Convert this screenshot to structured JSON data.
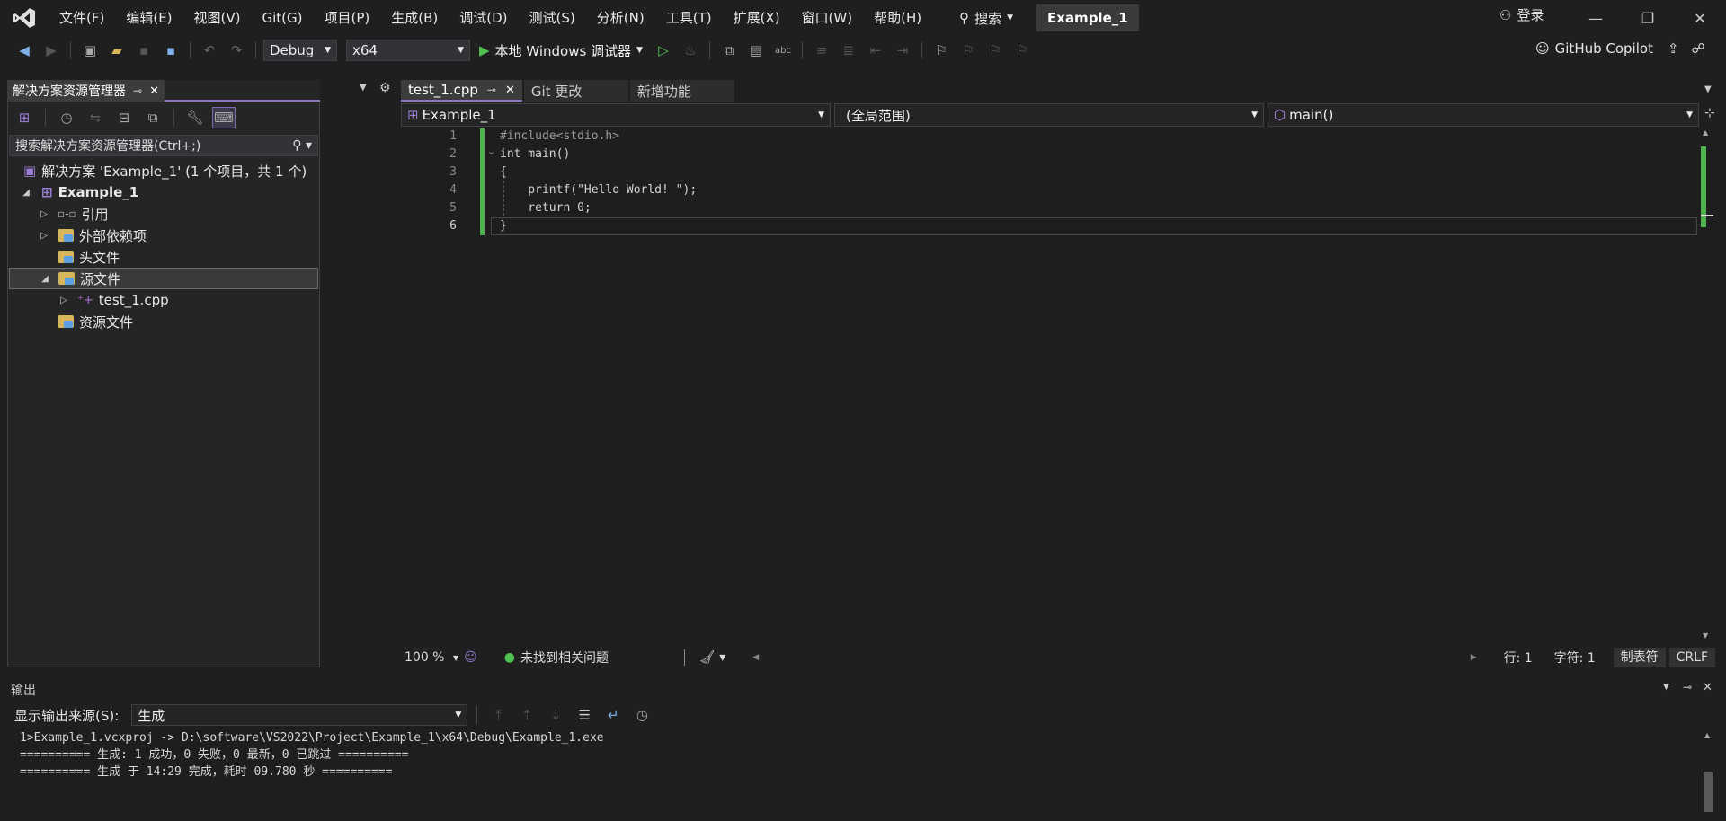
{
  "menu": [
    "文件(F)",
    "编辑(E)",
    "视图(V)",
    "Git(G)",
    "项目(P)",
    "生成(B)",
    "调试(D)",
    "测试(S)",
    "分析(N)",
    "工具(T)",
    "扩展(X)",
    "窗口(W)",
    "帮助(H)"
  ],
  "search_label": "搜索",
  "solution_name": "Example_1",
  "login_label": "登录",
  "toolbar": {
    "config": "Debug",
    "platform": "x64",
    "debugger": "本地 Windows 调试器",
    "copilot": "GitHub Copilot"
  },
  "solution_explorer": {
    "title": "解决方案资源管理器",
    "search_placeholder": "搜索解决方案资源管理器(Ctrl+;)",
    "tree": [
      {
        "label": "解决方案 'Example_1' (1 个项目，共 1 个)"
      },
      {
        "label": "Example_1"
      },
      {
        "label": "引用"
      },
      {
        "label": "外部依赖项"
      },
      {
        "label": "头文件"
      },
      {
        "label": "源文件"
      },
      {
        "label": "test_1.cpp"
      },
      {
        "label": "资源文件"
      }
    ]
  },
  "editor": {
    "tabs": [
      "test_1.cpp",
      "Git 更改",
      "新增功能"
    ],
    "nav": {
      "project": "Example_1",
      "scope": "(全局范围)",
      "member": "main()"
    },
    "lines": [
      {
        "num": "1",
        "text": "#include<stdio.h>"
      },
      {
        "num": "2",
        "text": "int main()"
      },
      {
        "num": "3",
        "text": "{"
      },
      {
        "num": "4",
        "text": "    printf(\"Hello World! \");"
      },
      {
        "num": "5",
        "text": "    return 0;"
      },
      {
        "num": "6",
        "text": "}"
      }
    ],
    "zoom": "100 %",
    "issues": "未找到相关问题",
    "row": "行: 1",
    "col": "字符: 1",
    "indent": "制表符",
    "eol": "CRLF"
  },
  "output": {
    "title": "输出",
    "source_label": "显示输出来源(S):",
    "source_value": "生成",
    "lines": [
      "1>Example_1.vcxproj -> D:\\software\\VS2022\\Project\\Example_1\\x64\\Debug\\Example_1.exe",
      "========== 生成: 1 成功，0 失败，0 最新，0 已跳过 ==========",
      "========== 生成 于 14:29 完成，耗时 09.780 秒 =========="
    ]
  },
  "colors": {
    "accent": "#8f74c8",
    "change_bar": "#4fb14f",
    "keyword": "#569cd6",
    "string": "#d69d85",
    "preproc": "#9b9b9b"
  }
}
